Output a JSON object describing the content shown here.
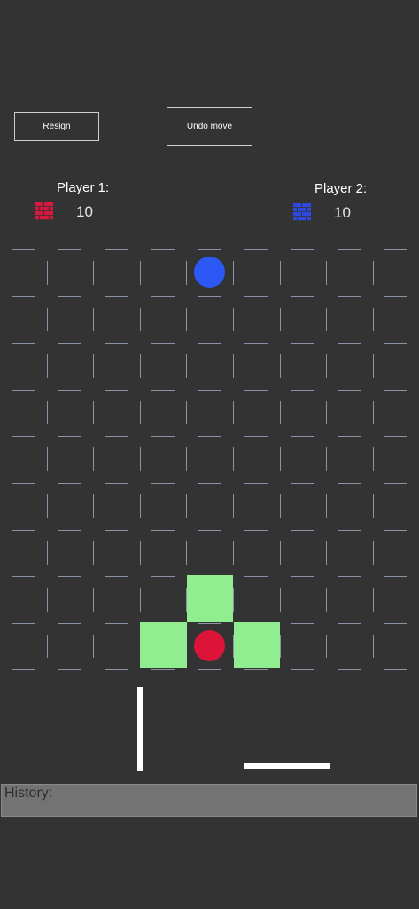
{
  "toolbar": {
    "resign_label": "Resign",
    "undo_label": "Undo move"
  },
  "players": [
    {
      "label": "Player 1:",
      "walls": "10",
      "color": "#d6183f"
    },
    {
      "label": "Player 2:",
      "walls": "10",
      "color": "#2f49e0"
    }
  ],
  "board": {
    "size": 9,
    "pawns": [
      {
        "player": 1,
        "col": 4,
        "row": 8,
        "color": "#dc1439"
      },
      {
        "player": 2,
        "col": 4,
        "row": 0,
        "color": "#2c59f5"
      }
    ],
    "valid_moves": [
      {
        "col": 4,
        "row": 7
      },
      {
        "col": 3,
        "row": 8
      },
      {
        "col": 5,
        "row": 8
      }
    ],
    "highlight_color": "#90ee90"
  },
  "history": {
    "label": "History:"
  }
}
